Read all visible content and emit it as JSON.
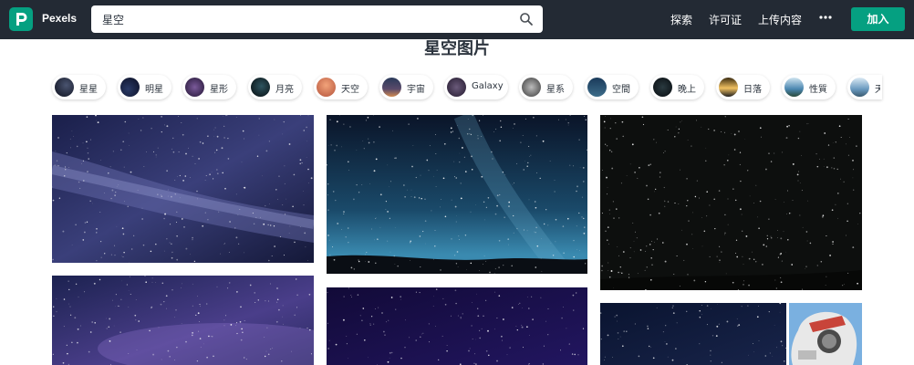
{
  "app": {
    "name": "Pexels"
  },
  "search": {
    "value": "星空"
  },
  "nav": {
    "explore": "探索",
    "license": "许可证",
    "upload": "上传内容",
    "join": "加入"
  },
  "page": {
    "title": "星空图片"
  },
  "chips": [
    {
      "label": "星星"
    },
    {
      "label": "明星"
    },
    {
      "label": "星形"
    },
    {
      "label": "月亮"
    },
    {
      "label": "天空"
    },
    {
      "label": "宇宙"
    },
    {
      "label": "Galaxy"
    },
    {
      "label": "星系"
    },
    {
      "label": "空間"
    },
    {
      "label": "晚上"
    },
    {
      "label": "日落"
    },
    {
      "label": "性質"
    },
    {
      "label": "天"
    }
  ],
  "colors": {
    "brand": "#05a081",
    "topbar": "#232a34"
  }
}
